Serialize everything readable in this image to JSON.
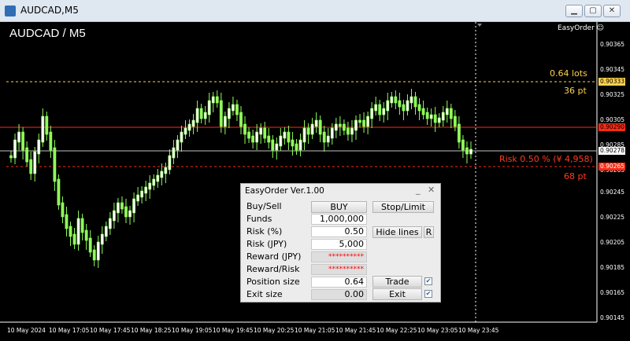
{
  "window": {
    "title": "AUDCAD,M5"
  },
  "chart": {
    "symbol": "AUDCAD / M5",
    "ea_label": "EasyOrder",
    "price_levels": [
      "0.90365",
      "0.90345",
      "0.90325",
      "0.90305",
      "0.90285",
      "0.90265",
      "0.90245",
      "0.90225",
      "0.90205",
      "0.90185",
      "0.90165",
      "0.90145"
    ],
    "tags": {
      "target": "0.90333",
      "entry_line": "0.90290",
      "current": "0.90278",
      "stop": "0.90265"
    },
    "colors": {
      "target": "#ffd24d",
      "red": "#ff3b1f",
      "white": "#ffffff"
    },
    "time_labels": [
      "10 May 2024",
      "10 May 17:05",
      "10 May 17:45",
      "10 May 18:25",
      "10 May 19:05",
      "10 May 19:45",
      "10 May 20:25",
      "10 May 21:05",
      "10 May 21:45",
      "10 May 22:25",
      "10 May 23:05",
      "10 May 23:45"
    ],
    "annotations": {
      "lots": "0.64 lots",
      "tp_pt": "36 pt",
      "risk": "Risk 0.50 % (¥ 4,958)",
      "sl_pt": "68 pt"
    }
  },
  "panel": {
    "title": "EasyOrder Ver.1.00",
    "minimize": "_",
    "close": "✕",
    "rows": {
      "buysell": {
        "label": "Buy/Sell",
        "value": "BUY"
      },
      "funds": {
        "label": "Funds",
        "value": "1,000,000"
      },
      "risk_pct": {
        "label": "Risk (%)",
        "value": "0.50"
      },
      "risk_jpy": {
        "label": "Risk (JPY)",
        "value": "5,000"
      },
      "reward_jpy": {
        "label": "Reward (JPY)",
        "value": "**********"
      },
      "reward_risk": {
        "label": "Reward/Risk",
        "value": "**********"
      },
      "position": {
        "label": "Position size",
        "value": "0.64"
      },
      "exit_size": {
        "label": "Exit size",
        "value": "0.00"
      }
    },
    "buttons": {
      "stop_limit": "Stop/Limit",
      "hide_lines": "Hide lines",
      "r": "R",
      "trade": "Trade",
      "exit": "Exit"
    },
    "checks": {
      "trade": true,
      "exit": true
    }
  }
}
